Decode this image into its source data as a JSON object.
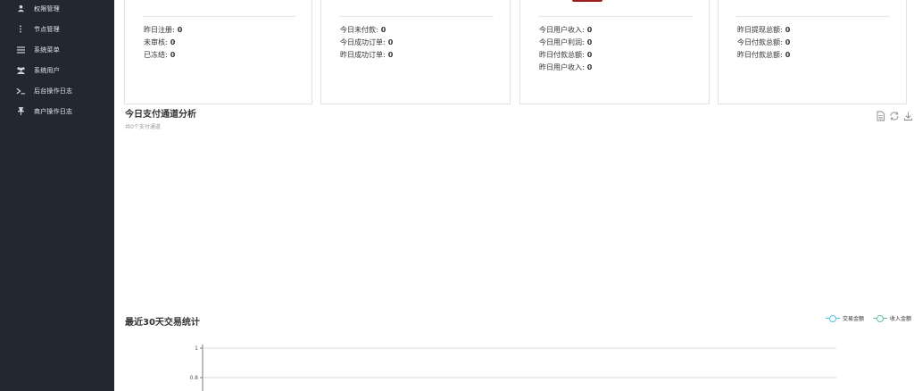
{
  "sidebar": {
    "items": [
      {
        "label": "权限管理",
        "icon": "users-group-icon"
      },
      {
        "label": "节点管理",
        "icon": "ellipsis-vertical-icon"
      },
      {
        "label": "系统菜单",
        "icon": "menu-icon"
      },
      {
        "label": "系统用户",
        "icon": "users-icon"
      },
      {
        "label": "后台操作日志",
        "icon": "terminal-icon"
      },
      {
        "label": "商户操作日志",
        "icon": "pin-icon"
      }
    ]
  },
  "cards": [
    {
      "rows": [
        {
          "label": "昨日注册:",
          "value": "0"
        },
        {
          "label": "未审核:",
          "value": "0"
        },
        {
          "label": "已冻结:",
          "value": "0"
        }
      ]
    },
    {
      "rows": [
        {
          "label": "今日未付款:",
          "value": "0"
        },
        {
          "label": "今日成功订单:",
          "value": "0"
        },
        {
          "label": "昨日成功订单:",
          "value": "0"
        }
      ]
    },
    {
      "rows": [
        {
          "label": "今日用户收入:",
          "value": "0"
        },
        {
          "label": "今日用户利润:",
          "value": "0"
        },
        {
          "label": "昨日付款总额:",
          "value": "0"
        },
        {
          "label": "昨日用户收入:",
          "value": "0"
        }
      ]
    },
    {
      "rows": [
        {
          "label": "昨日提现总额:",
          "value": "0"
        },
        {
          "label": "今日付款总额:",
          "value": "0"
        },
        {
          "label": "昨日付款总额:",
          "value": "0"
        }
      ]
    }
  ],
  "channel_section": {
    "title": "今日支付通道分析",
    "subtitle": "共0个支付通道",
    "tools": [
      "document-icon",
      "refresh-icon",
      "download-icon"
    ]
  },
  "trend_section": {
    "title": "最近30天交易统计",
    "legend": [
      {
        "name": "交易金额",
        "color": "#4ec3e0"
      },
      {
        "name": "收入金额",
        "color": "#5ec69a"
      }
    ]
  },
  "chart_data": {
    "type": "line",
    "title": "最近30天交易统计",
    "series": [
      {
        "name": "交易金额",
        "values": []
      },
      {
        "name": "收入金额",
        "values": []
      }
    ],
    "y_ticks_visible": [
      "1",
      "0.8"
    ],
    "grid": true
  }
}
